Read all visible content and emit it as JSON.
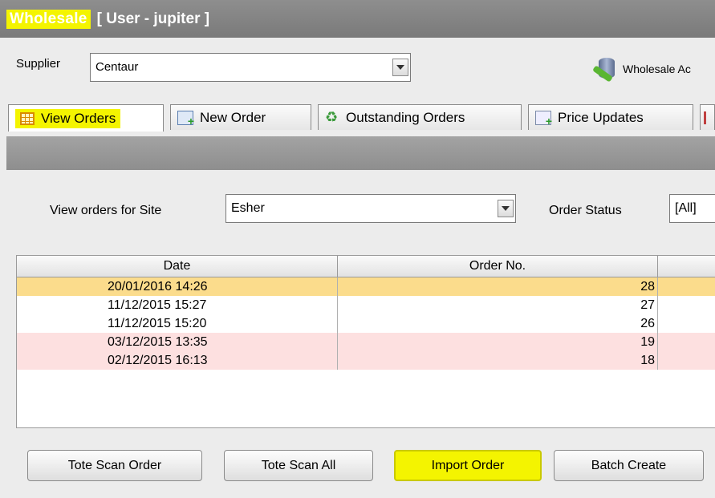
{
  "titlebar": {
    "app_name": "Wholesale",
    "user": "[ User - jupiter ]"
  },
  "supplier": {
    "label": "Supplier",
    "value": "Centaur"
  },
  "toolbar": {
    "wholesale_link": "Wholesale Ac"
  },
  "tabs": [
    {
      "label": "View Orders",
      "active": true
    },
    {
      "label": "New Order"
    },
    {
      "label": "Outstanding Orders"
    },
    {
      "label": "Price Updates"
    }
  ],
  "filters": {
    "site_label": "View orders for Site",
    "site_value": "Esher",
    "status_label": "Order Status",
    "status_value": "[All]"
  },
  "table": {
    "columns": [
      "Date",
      "Order No."
    ],
    "rows": [
      {
        "date": "20/01/2016 14:26",
        "order_no": "28",
        "highlight": "selected"
      },
      {
        "date": "11/12/2015 15:27",
        "order_no": "27",
        "highlight": "none"
      },
      {
        "date": "11/12/2015 15:20",
        "order_no": "26",
        "highlight": "none"
      },
      {
        "date": "03/12/2015 13:35",
        "order_no": "19",
        "highlight": "pink"
      },
      {
        "date": "02/12/2015 16:13",
        "order_no": "18",
        "highlight": "pink"
      }
    ]
  },
  "buttons": {
    "tote_scan_order": "Tote Scan Order",
    "tote_scan_all": "Tote Scan All",
    "import_order": "Import Order",
    "batch_create": "Batch Create"
  },
  "colors": {
    "selected_row": "#fbdc8c",
    "pink_row": "#fde0e0",
    "highlight": "#f4f400"
  }
}
